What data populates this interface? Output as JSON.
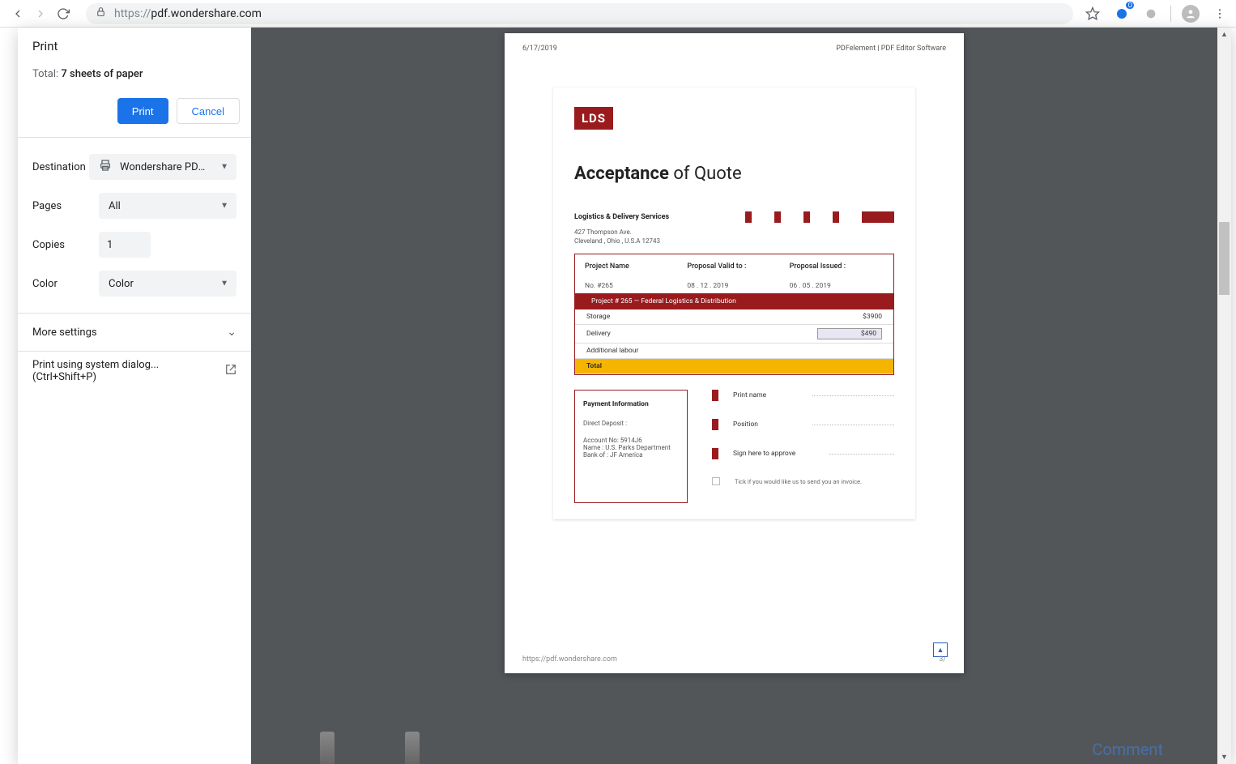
{
  "browser": {
    "url_scheme": "https://",
    "url_domain": "pdf.wondershare.com",
    "url_full": "https://pdf.wondershare.com",
    "ext_badge": "O"
  },
  "print": {
    "title": "Print",
    "total_prefix": "Total: ",
    "total_value": "7 sheets of paper",
    "btn_print": "Print",
    "btn_cancel": "Cancel",
    "destination_label": "Destination",
    "destination_value": "Wondershare PDFel",
    "pages_label": "Pages",
    "pages_value": "All",
    "copies_label": "Copies",
    "copies_value": "1",
    "color_label": "Color",
    "color_value": "Color",
    "more_settings": "More settings",
    "system_dialog": "Print using system dialog... (Ctrl+Shift+P)"
  },
  "page_header": {
    "date": "6/17/2019",
    "title": "PDFelement | PDF Editor Software"
  },
  "doc": {
    "logo": "LDS",
    "title_bold": "Acceptance",
    "title_rest": " of Quote",
    "company": "Logistics & Delivery Services",
    "addr1": "427 Thompson Ave.",
    "addr2": "Cleveland , Ohio , U.S.A 12743",
    "meta": {
      "project_name_h": "Project Name",
      "project_name_v": "No. #265",
      "valid_h": "Proposal Valid to :",
      "valid_v": "08 . 12 . 2019",
      "issued_h": "Proposal Issued :",
      "issued_v": "06 . 05 . 2019"
    },
    "table_header": "Project # 265 — Federal Logistics & Distribution",
    "rows": [
      {
        "item": "Storage",
        "price": "$3900"
      },
      {
        "item": "Delivery",
        "price": "$490"
      },
      {
        "item": "Additional labour",
        "price": ""
      }
    ],
    "total_label": "Total",
    "pay": {
      "title": "Payment Information",
      "dd": "Direct Deposit :",
      "acc": "Account No: 5914J6",
      "name": "Name :  U.S. Parks Department",
      "bank": "Bank of : JF America"
    },
    "sig": {
      "print_name": "Print name",
      "position": "Position",
      "sign": "Sign here to approve",
      "invoice": "Tick if you would like us to send you an invoice."
    },
    "footer_url": "https://pdf.wondershare.com",
    "footer_pg": "3/"
  },
  "bottom": {
    "comment": "Comment"
  }
}
